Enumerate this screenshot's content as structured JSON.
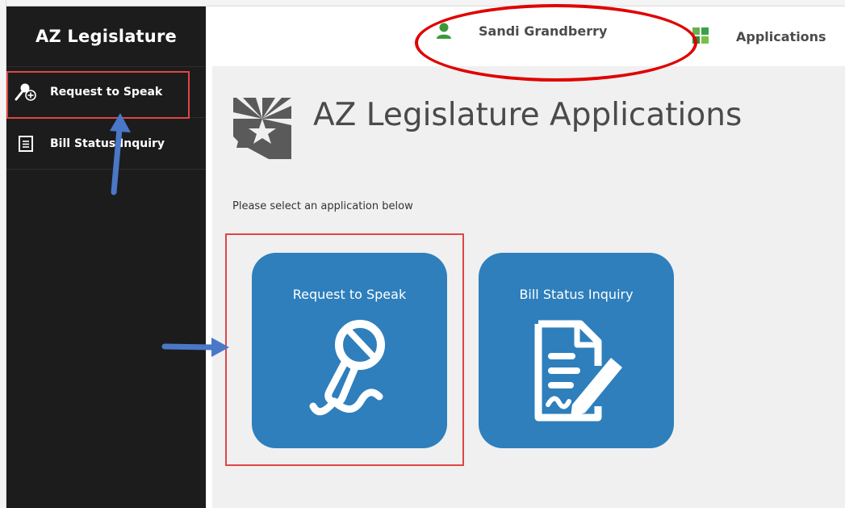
{
  "sidebar": {
    "brand": "AZ Legislature",
    "items": [
      {
        "label": "Request to Speak",
        "icon": "microphone-add-icon",
        "active": true
      },
      {
        "label": "Bill Status Inquiry",
        "icon": "document-icon",
        "active": false
      }
    ]
  },
  "topbar": {
    "user_name": "Sandi Grandberry",
    "user_icon": "user-icon",
    "applications_label": "Applications",
    "applications_icon": "grid-icon"
  },
  "main": {
    "title": "AZ Legislature Applications",
    "instructions": "Please select an application below",
    "tiles": [
      {
        "label": "Request to Speak",
        "icon": "microphone-icon"
      },
      {
        "label": "Bill Status Inquiry",
        "icon": "document-pen-icon"
      }
    ]
  },
  "colors": {
    "sidebar_bg": "#1c1c1c",
    "tile_bg": "#2e7fbc",
    "annotation_red": "#e00000",
    "annotation_arrow": "#4a78c8",
    "user_icon_green": "#3a9a3a"
  }
}
